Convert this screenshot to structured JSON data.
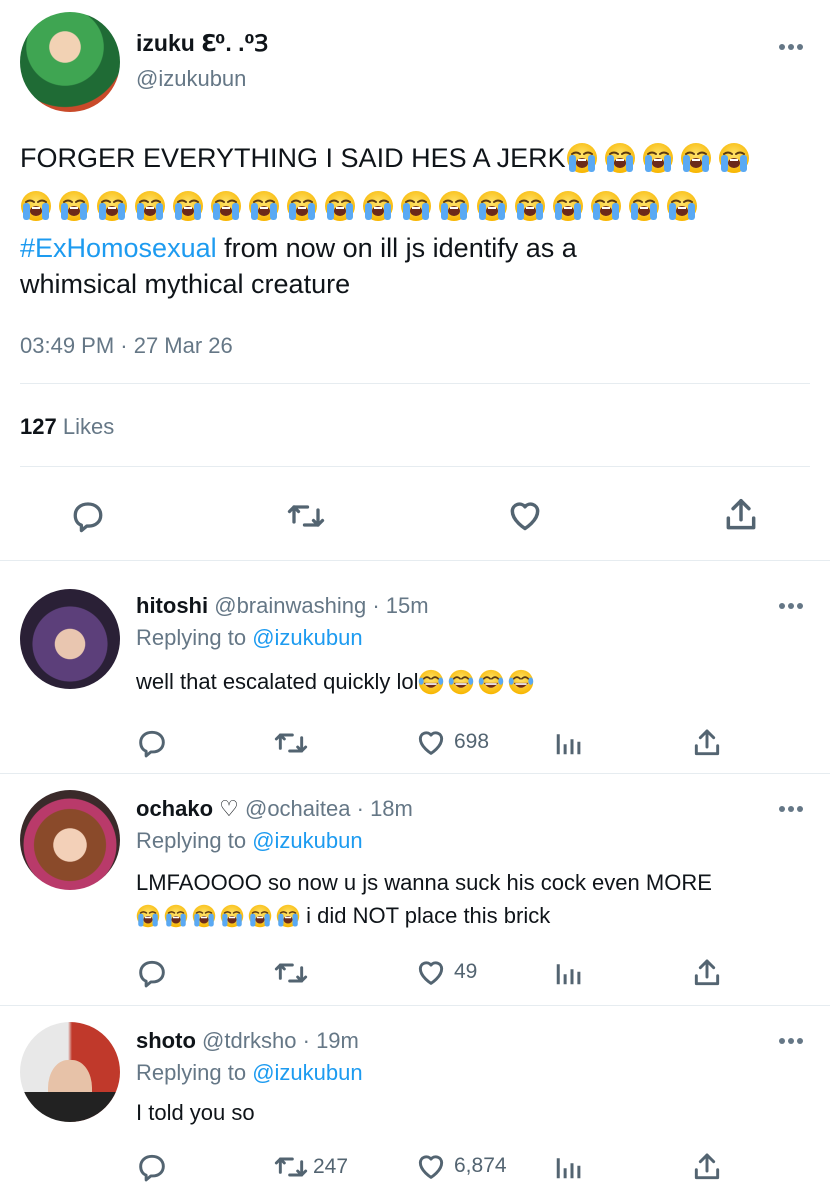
{
  "main_tweet": {
    "display_name": "izuku ℇ⁰. .⁰Ɜ",
    "handle": "@izukubun",
    "text_line1": "FORGER EVERYTHING I SAID HES A JERK",
    "hashtag": "#ExHomosexual",
    "text_rest1": " from now on ill js identify as a",
    "text_rest2": "whimsical mythical creature",
    "loudly_crying_emoji_count_line1": 5,
    "loudly_crying_emoji_count_line2": 18,
    "timestamp": "03:49 PM · 27 Mar 26",
    "likes_count": "127",
    "likes_label": "Likes"
  },
  "replies": [
    {
      "display_name": "hitoshi",
      "handle": "@brainwashing",
      "time": "· 15m",
      "replying_prefix": "Replying to ",
      "replying_to": "@izukubun",
      "text": "well that escalated quickly lol",
      "emoji": "tears-of-joy",
      "emoji_count": 4,
      "retweets": "",
      "likes": "698"
    },
    {
      "display_name": "ochako ♡",
      "handle": "@ochaitea",
      "time": "· 18m",
      "replying_prefix": "Replying to ",
      "replying_to": "@izukubun",
      "text": "LMFAOOOO so now u js wanna suck his cock even MORE",
      "text2": " i did NOT place this brick",
      "emoji": "loudly-crying",
      "emoji_count": 6,
      "retweets": "",
      "likes": "49"
    },
    {
      "display_name": "shoto",
      "handle": "@tdrksho",
      "time": "· 19m",
      "replying_prefix": "Replying to ",
      "replying_to": "@izukubun",
      "text": "I told you so",
      "retweets": "247",
      "likes": "6,874"
    }
  ],
  "colors": {
    "link": "#1d9bf0",
    "gray": "#657786",
    "divider": "#e6ecf0"
  }
}
